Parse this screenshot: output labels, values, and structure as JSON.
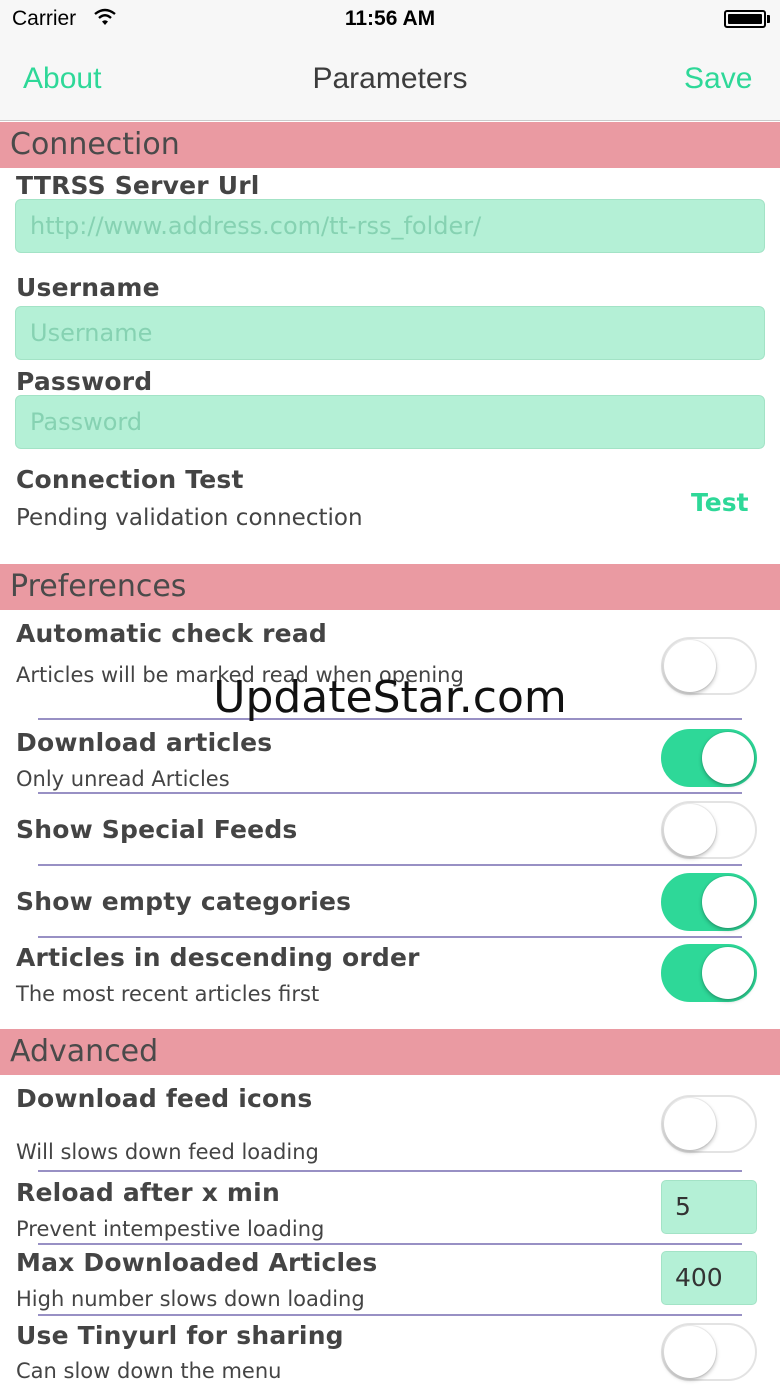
{
  "status_bar": {
    "carrier": "Carrier",
    "time": "11:56 AM"
  },
  "nav": {
    "left_label": "About",
    "title": "Parameters",
    "right_label": "Save"
  },
  "colors": {
    "accent": "#2ed898",
    "section_header": "#ea9aa2",
    "field_background": "#b4f0d6",
    "divider": "#9890c4"
  },
  "connection": {
    "header": "Connection",
    "server_label": "TTRSS Server Url",
    "server_placeholder": "http://www.address.com/tt-rss_folder/",
    "username_label": "Username",
    "username_placeholder": "Username",
    "password_label": "Password",
    "password_placeholder": "Password",
    "test_label": "Connection Test",
    "test_status": "Pending validation connection",
    "test_button": "Test"
  },
  "preferences": {
    "header": "Preferences",
    "items": [
      {
        "label": "Automatic check read",
        "sub": "Articles will be marked read  when opening",
        "on": false
      },
      {
        "label": "Download articles",
        "sub": "Only unread Articles",
        "on": true
      },
      {
        "label": "Show Special Feeds",
        "sub": "",
        "on": false
      },
      {
        "label": "Show empty categories",
        "sub": "",
        "on": true
      },
      {
        "label": "Articles in descending order",
        "sub": "The most recent articles first",
        "on": true
      }
    ]
  },
  "advanced": {
    "header": "Advanced",
    "feed_icons_label": "Download feed icons",
    "feed_icons_sub": "Will slows down feed loading",
    "feed_icons_on": false,
    "reload_label": "Reload after x min",
    "reload_sub": "Prevent intempestive loading",
    "reload_value": "5",
    "max_label": "Max Downloaded Articles",
    "max_sub": "High number slows down loading",
    "max_value": "400",
    "tinyurl_label": "Use Tinyurl for sharing",
    "tinyurl_sub": "Can slow down the menu",
    "tinyurl_on": false
  },
  "watermark": "UpdateStar.com"
}
